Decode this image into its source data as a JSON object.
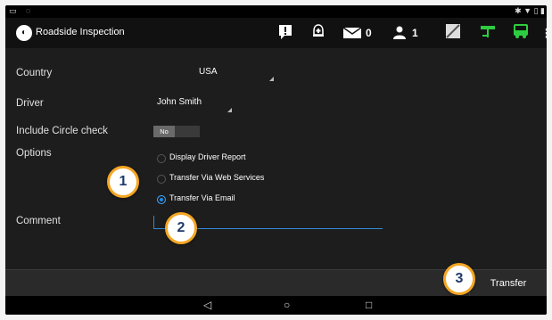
{
  "actionbar": {
    "title": "Roadside Inspection",
    "messages_count": "0",
    "users_count": "1"
  },
  "form": {
    "country_label": "Country",
    "country_value": "USA",
    "driver_label": "Driver",
    "driver_value": "John Smith",
    "circle_label": "Include Circle check",
    "circle_toggle": "No",
    "options_label": "Options",
    "options": [
      {
        "label": "Display Driver Report",
        "selected": false
      },
      {
        "label": "Transfer Via Web Services",
        "selected": false
      },
      {
        "label": "Transfer Via Email",
        "selected": true
      }
    ],
    "comment_label": "Comment",
    "comment_value": ""
  },
  "bottombar": {
    "transfer_label": "Transfer"
  },
  "callouts": [
    "1",
    "2",
    "3"
  ],
  "colors": {
    "accent_blue": "#2f8bd8",
    "callout_border": "#f5a623",
    "green_icon": "#2ecc40"
  }
}
